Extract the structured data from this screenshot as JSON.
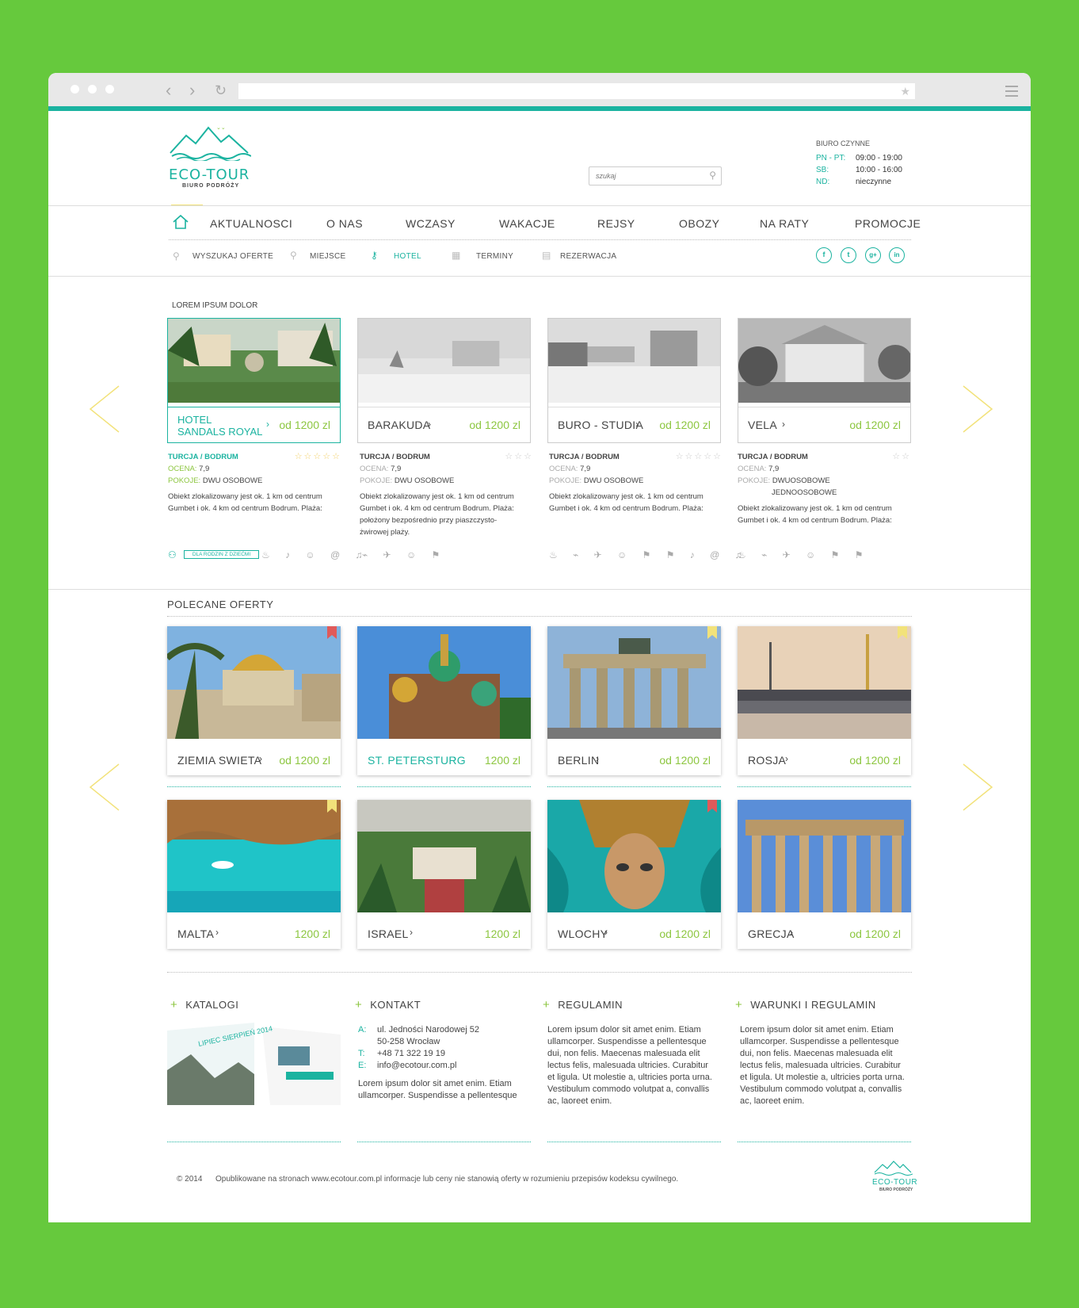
{
  "header": {
    "logo_title": "ECO-TOUR",
    "logo_sub": "BIURO PODRÓŻY",
    "search_placeholder": "szukaj",
    "hours_title": "BIURO CZYNNE",
    "hours": [
      {
        "day": "PN - PT:",
        "time": "09:00 - 19:00"
      },
      {
        "day": "SB:",
        "time": "10:00 - 16:00"
      },
      {
        "day": "ND:",
        "time": "nieczynne"
      }
    ]
  },
  "nav": [
    "AKTUALNOSCI",
    "O NAS",
    "WCZASY",
    "WAKACJE",
    "REJSY",
    "OBOZY",
    "NA RATY",
    "PROMOCJE"
  ],
  "subnav": [
    "WYSZUKAJ OFERTE",
    "MIEJSCE",
    "HOTEL",
    "TERMINY",
    "REZERWACJA"
  ],
  "social": [
    "f",
    "t",
    "g+",
    "in"
  ],
  "hotels_title": "LOREM IPSUM DOLOR",
  "hotels": [
    {
      "name1": "HOTEL",
      "name2": "SANDALS ROYAL",
      "price": "od 1200 zl",
      "loc": "TURCJA / BODRUM",
      "ocena_l": "OCENA:",
      "ocena": "7,9",
      "pokoje_l": "POKOJE:",
      "pokoje": "DWU OSOBOWE",
      "pokoje2": "",
      "desc": "Obiekt zlokalizowany jest ok. 1 km od centrum Gumbet i ok. 4 km od centrum Bodrum. Plaża:",
      "stars": "☆☆☆☆☆",
      "tag": "DLA RODZIN Z DZIEĆMI",
      "amen": "♨ ♪ ☺ @ ♫"
    },
    {
      "name1": "BARAKUDA",
      "name2": "",
      "price": "od 1200 zl",
      "loc": "TURCJA / BODRUM",
      "ocena_l": "OCENA:",
      "ocena": "7,9",
      "pokoje_l": "POKOJE:",
      "pokoje": "DWU OSOBOWE",
      "pokoje2": "",
      "desc": "Obiekt zlokalizowany jest ok. 1 km od centrum Gumbet i ok. 4 km od centrum Bodrum. Plaża: położony bezpośrednio przy piaszczysto-żwirowej plaży.",
      "stars": "☆☆☆",
      "tag": "",
      "amen": "⌁ ✈ ☺ ⚑"
    },
    {
      "name1": "BURO - STUDIA",
      "name2": "",
      "price": "od 1200 zl",
      "loc": "TURCJA / BODRUM",
      "ocena_l": "OCENA:",
      "ocena": "7,9",
      "pokoje_l": "POKOJE:",
      "pokoje": "DWU OSOBOWE",
      "pokoje2": "",
      "desc": "Obiekt zlokalizowany jest ok. 1 km od centrum Gumbet i ok. 4 km od centrum Bodrum. Plaża:",
      "stars": "☆☆☆☆☆",
      "tag": "",
      "amen": "♨ ⌁ ✈ ☺ ⚑ ⚑ ♪ @ ♫"
    },
    {
      "name1": "VELA",
      "name2": "",
      "price": "od 1200 zl",
      "loc": "TURCJA / BODRUM",
      "ocena_l": "OCENA:",
      "ocena": "7,9",
      "pokoje_l": "POKOJE:",
      "pokoje": "DWUOSOBOWE",
      "pokoje2": "JEDNOOSOBOWE",
      "desc": "Obiekt zlokalizowany jest ok. 1 km od centrum Gumbet i ok. 4 km od centrum Bodrum. Plaża:",
      "stars": "☆☆",
      "tag": "",
      "amen": "♨ ⌁ ✈ ☺ ⚑ ⚑"
    }
  ],
  "offers_title": "POLECANE OFERTY",
  "offers": [
    {
      "name": "ZIEMIA SWIETA",
      "price": "od 1200 zl",
      "teal": false
    },
    {
      "name": "ST. PETERSTURG",
      "price": "1200 zl",
      "teal": true
    },
    {
      "name": "BERLIN",
      "price": "od 1200 zl",
      "teal": false
    },
    {
      "name": "ROSJA",
      "price": "od 1200 zl",
      "teal": false
    },
    {
      "name": "MALTA",
      "price": "1200 zl",
      "teal": false
    },
    {
      "name": "ISRAEL",
      "price": "1200 zl",
      "teal": false
    },
    {
      "name": "WLOCHY",
      "price": "od 1200 zl",
      "teal": false
    },
    {
      "name": "GRECJA",
      "price": "od 1200 zl",
      "teal": false
    }
  ],
  "footer": {
    "katalogi": "KATALOGI",
    "katalog_img": "LIPIEC SIERPIEŃ 2014",
    "kontakt": "KONTAKT",
    "contact": [
      {
        "l": "A:",
        "v": "ul. Jedności Narodowej 52"
      },
      {
        "l": "",
        "v": "50-258 Wrocław"
      },
      {
        "l": "T:",
        "v": "+48 71 322 19 19"
      },
      {
        "l": "E:",
        "v": "info@ecotour.com.pl"
      }
    ],
    "kontakt_text": "Lorem ipsum dolor sit amet enim. Etiam ullamcorper. Suspendisse a pellentesque",
    "regulamin": "REGULAMIN",
    "regulamin_text": "Lorem ipsum dolor sit amet enim. Etiam ullamcorper. Suspendisse a pellentesque dui, non felis. Maecenas malesuada elit lectus felis, malesuada ultricies. Curabitur et ligula. Ut molestie a, ultricies porta urna. Vestibulum commodo volutpat a, convallis ac, laoreet enim.",
    "warunki": "WARUNKI I REGULAMIN",
    "warunki_text": "Lorem ipsum dolor sit amet enim. Etiam ullamcorper. Suspendisse a pellentesque dui, non felis. Maecenas malesuada elit lectus felis, malesuada ultricies. Curabitur et ligula. Ut molestie a, ultricies porta urna. Vestibulum commodo volutpat a, convallis ac, laoreet enim.",
    "copyright": "© 2014",
    "legal": "Opublikowane na stronach www.ecotour.com.pl informacje lub ceny nie stanowią oferty w rozumieniu przepisów kodeksu cywilnego.",
    "logo": "ECO-TOUR",
    "logo_sub": "BIURO PODRÓŻY"
  },
  "colors": {
    "bg": "#66c93d",
    "teal": "#1bb3a0",
    "green": "#8cc63f",
    "arrow": "#f2e27a"
  }
}
